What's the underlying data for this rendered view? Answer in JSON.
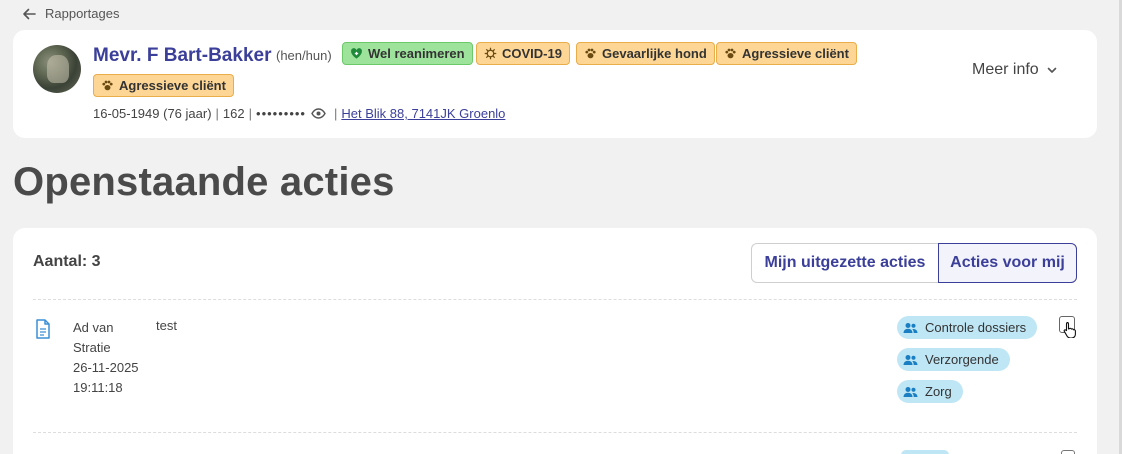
{
  "nav": {
    "back_label": "Rapportages"
  },
  "client": {
    "name": "Mevr. F Bart-Bakker",
    "pronoun": "(hen/hun)",
    "badges": [
      {
        "label": "Wel reanimeren",
        "icon": "heart-icon",
        "color": "#9ee39c"
      },
      {
        "label": "COVID-19",
        "icon": "virus-icon",
        "color": "#fdd696"
      },
      {
        "label": "Gevaarlijke hond",
        "icon": "paw-icon",
        "color": "#fdd696"
      },
      {
        "label": "Agressieve cliënt",
        "icon": "paw-icon",
        "color": "#fdd696"
      },
      {
        "label": "Agressieve cliënt",
        "icon": "paw-icon",
        "color": "#fdd696"
      }
    ],
    "birth": "16-05-1949 (76 jaar)",
    "id": "162",
    "masked_bsn": "•••••••••",
    "address": "Het Blik 88, 7141JK Groenlo",
    "more_info_label": "Meer info"
  },
  "page": {
    "title": "Openstaande acties"
  },
  "actions": {
    "count_label": "Aantal: 3",
    "tabs": [
      {
        "label": "Mijn uitgezette acties",
        "active": false
      },
      {
        "label": "Acties voor mij",
        "active": true
      }
    ],
    "rows": [
      {
        "author": "Ad van Stratie",
        "date": "26-11-2025",
        "time": "19:11:18",
        "message": "test",
        "groups": [
          "Controle dossiers",
          "Verzorgende",
          "Zorg"
        ]
      }
    ]
  },
  "colors": {
    "brand": "#3b3f99",
    "group_pill": "#bfe6f5"
  }
}
